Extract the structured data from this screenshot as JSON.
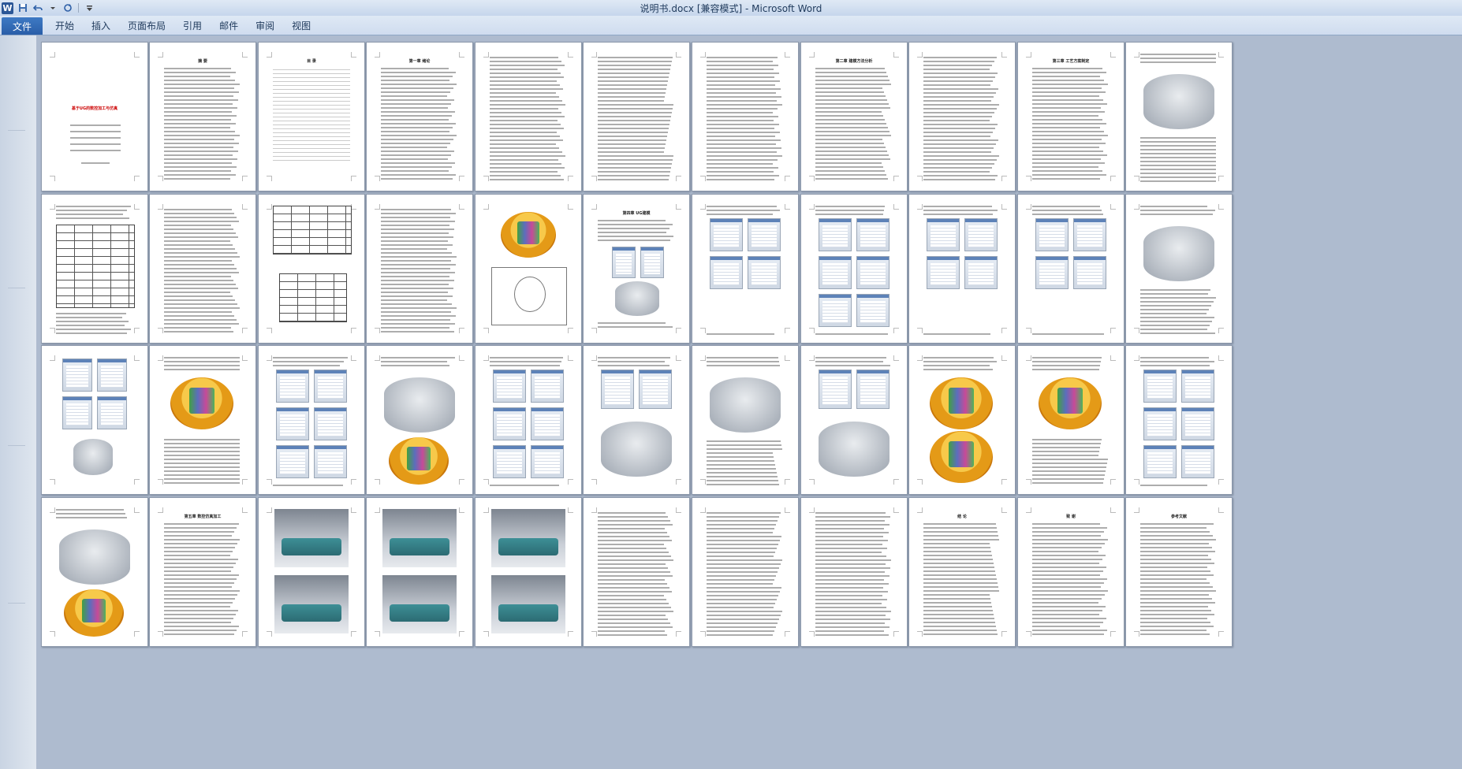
{
  "window": {
    "title": "说明书.docx [兼容模式] - Microsoft Word",
    "app_icon": "W"
  },
  "qat": {
    "save_icon": "save-icon",
    "undo_icon": "undo-icon",
    "redo_icon": "redo-icon",
    "customize_icon": "dropdown-icon"
  },
  "ribbon": {
    "file_tab": "文件",
    "tabs": [
      "开始",
      "插入",
      "页面布局",
      "引用",
      "邮件",
      "审阅",
      "视图"
    ]
  },
  "colors": {
    "file_tab": "#2a5ea8",
    "titlebar": "#dfe9f5",
    "page_area": "#aebbcf"
  },
  "document": {
    "cover_title": "基于UG的数控加工与仿真",
    "toc_title": "目 录",
    "abstract_title": "摘 要",
    "ch1_title": "第一章 绪论",
    "ch2_title": "第二章 建模方法分析",
    "ch3_title": "第三章 工艺方案制定",
    "ch4_title": "第四章 UG建模",
    "ch5_title": "第五章 数控仿真加工",
    "conclusion_title": "结 论",
    "thanks_title": "致 谢",
    "refs_title": "参考文献"
  }
}
